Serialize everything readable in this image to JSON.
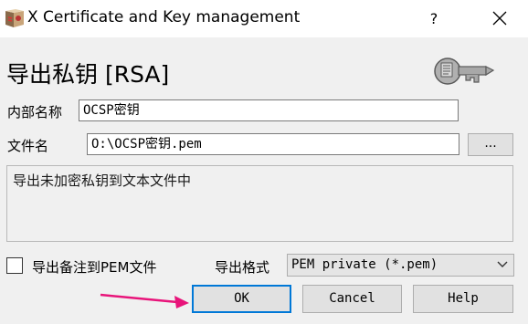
{
  "window": {
    "title": "X Certificate and Key management",
    "help_glyph": "?",
    "close_icon": "close-icon",
    "app_icon": "xca-app-icon"
  },
  "dialog": {
    "heading": "导出私钥 [RSA]",
    "key_icon": "key-icon",
    "name_label": "内部名称",
    "name_value": "OCSP密钥",
    "file_label": "文件名",
    "file_value": "O:\\OCSP密钥.pem",
    "browse_label": "...",
    "description": "导出未加密私钥到文本文件中",
    "comment_checkbox_label": "导出备注到PEM文件",
    "comment_checked": false,
    "format_label": "导出格式",
    "format_selected": "PEM private (*.pem)"
  },
  "buttons": {
    "ok": "OK",
    "cancel": "Cancel",
    "help": "Help"
  },
  "colors": {
    "default_button_border": "#0078d7",
    "annotation_arrow": "#e8147a"
  }
}
